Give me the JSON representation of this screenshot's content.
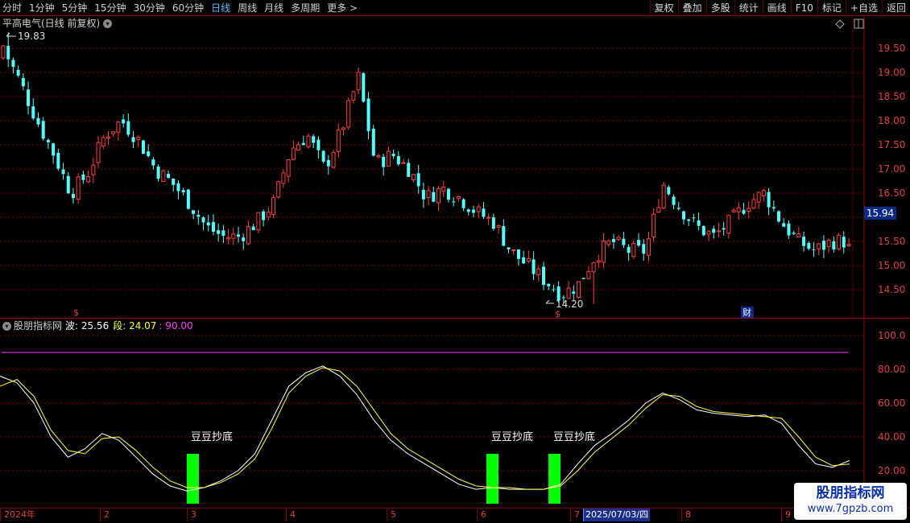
{
  "toolbar": {
    "periods": [
      "分时",
      "1分钟",
      "5分钟",
      "15分钟",
      "30分钟",
      "60分钟",
      "日线",
      "周线",
      "月线",
      "多周期",
      "更多 >"
    ],
    "active_period": "日线",
    "tools": [
      "复权",
      "叠加",
      "多股",
      "统计",
      "画线",
      "F10",
      "标记",
      "+自选",
      "返回"
    ]
  },
  "price_pane": {
    "title": "平高电气(日线 前复权)",
    "high_marker": "19.83",
    "low_marker": "14.20",
    "current_price": "15.94",
    "y_ticks": [
      "19.50",
      "19.00",
      "18.50",
      "18.00",
      "17.50",
      "17.00",
      "16.50",
      "15.50",
      "15.00",
      "14.50"
    ],
    "event_markers": [
      "$",
      "$",
      "财"
    ]
  },
  "indicator_pane": {
    "name": "股朋指标网",
    "wave_label": "波: 25.56",
    "segment_label": "段: 24.07",
    "level_label": ": 90.00",
    "y_ticks": [
      "100.0",
      "80.00",
      "60.00",
      "40.00",
      "20.00"
    ],
    "signal_label": "豆豆抄底"
  },
  "date_axis": {
    "labels": [
      "2024年",
      "2",
      "3",
      "4",
      "5",
      "6",
      "7",
      "2025/07/03/四",
      "8",
      "9"
    ]
  },
  "watermark": {
    "line1": "股朋指标网",
    "line2": "www.7gpzb.com"
  },
  "chart_data": [
    {
      "type": "candlestick",
      "title": "平高电气(日线 前复权)",
      "y_range": [
        14.2,
        19.83
      ],
      "y_ticks": [
        14.5,
        15.0,
        15.5,
        16.0,
        16.5,
        17.0,
        17.5,
        18.0,
        18.5,
        19.0,
        19.5
      ],
      "max_price": 19.83,
      "min_price": 14.2,
      "last_close": 15.94,
      "close_path": [
        19.5,
        18.8,
        18.0,
        17.3,
        16.5,
        16.9,
        17.7,
        18.0,
        17.6,
        17.0,
        16.7,
        16.3,
        15.8,
        15.6,
        15.6,
        15.9,
        16.3,
        17.4,
        17.7,
        17.0,
        17.8,
        18.9,
        17.1,
        17.3,
        17.0,
        16.4,
        16.6,
        16.4,
        16.1,
        15.9,
        15.3,
        15.0,
        14.7,
        14.4,
        14.6,
        15.2,
        15.5,
        15.3,
        15.3,
        16.7,
        16.2,
        15.8,
        15.6,
        15.9,
        16.3,
        16.5,
        15.9,
        15.5,
        15.3,
        15.5,
        15.5
      ]
    },
    {
      "type": "line",
      "title": "股朋指标网",
      "y_range": [
        10,
        105
      ],
      "series": [
        {
          "name": "波",
          "last": 25.56,
          "values": [
            76,
            72,
            60,
            40,
            28,
            33,
            42,
            38,
            28,
            18,
            11,
            8,
            10,
            14,
            20,
            30,
            50,
            70,
            78,
            82,
            76,
            65,
            50,
            38,
            30,
            24,
            18,
            12,
            9,
            10,
            9,
            9,
            9,
            12,
            24,
            35,
            42,
            50,
            60,
            66,
            62,
            56,
            54,
            53,
            52,
            53,
            48,
            35,
            24,
            22,
            26
          ]
        },
        {
          "name": "段",
          "last": 24.07,
          "values": [
            70,
            74,
            64,
            44,
            32,
            30,
            39,
            40,
            32,
            22,
            14,
            10,
            10,
            13,
            18,
            27,
            45,
            66,
            76,
            81,
            79,
            70,
            56,
            42,
            33,
            27,
            21,
            15,
            11,
            10,
            10,
            9,
            9,
            11,
            20,
            31,
            39,
            47,
            57,
            65,
            64,
            58,
            55,
            54,
            53,
            52,
            51,
            40,
            28,
            23,
            24
          ]
        },
        {
          "name": "",
          "last": 90.0,
          "values": [
            90,
            90
          ]
        }
      ],
      "signals": [
        {
          "label": "豆豆抄底",
          "month": "3"
        },
        {
          "label": "豆豆抄底",
          "month": "6"
        },
        {
          "label": "豆豆抄底",
          "month": "7"
        }
      ]
    }
  ],
  "colors": {
    "up": "#ff4040",
    "down": "#54ffff",
    "wave": "#ffffff",
    "segment": "#ffff40",
    "level": "#ff40ff",
    "signal": "#00ff00",
    "grid": "#8a0000"
  }
}
